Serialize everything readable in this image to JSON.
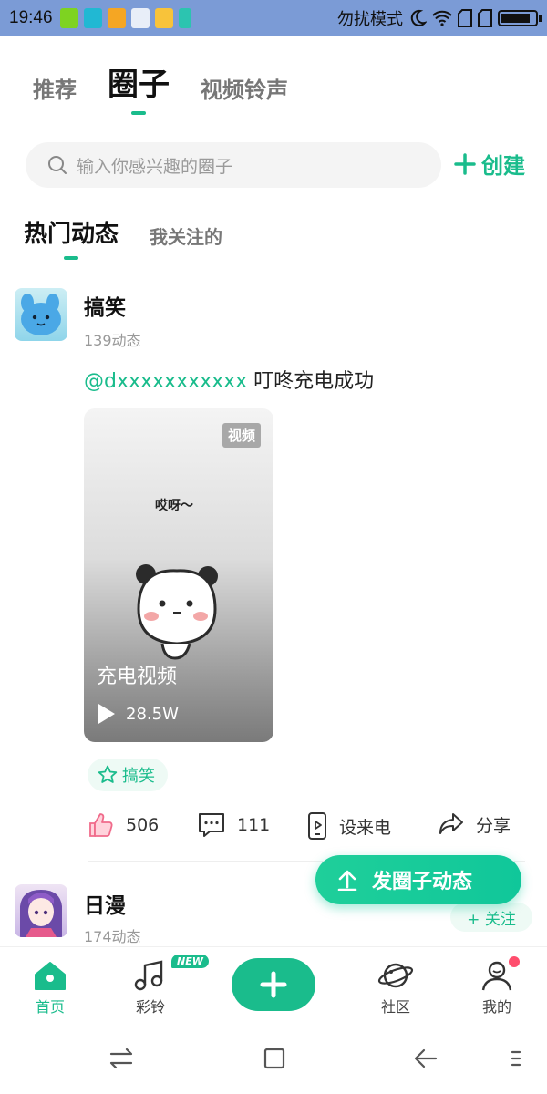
{
  "status_bar": {
    "time": "19:46",
    "mode_text": "勿扰模式",
    "battery_level": 0.85
  },
  "top_tabs": [
    {
      "label": "推荐",
      "active": false
    },
    {
      "label": "圈子",
      "active": true
    },
    {
      "label": "视频铃声",
      "active": false
    }
  ],
  "search": {
    "placeholder": "输入你感兴趣的圈子",
    "icon": "search-icon"
  },
  "create_button": {
    "label": "创建",
    "icon": "plus-icon"
  },
  "feed_tabs": [
    {
      "label": "热门动态",
      "active": true
    },
    {
      "label": "我关注的",
      "active": false
    }
  ],
  "posts": [
    {
      "name": "搞笑",
      "count": "139动态",
      "mention": "@dxxxxxxxxxxx",
      "text": " 叮咚充电成功",
      "video": {
        "badge": "视频",
        "caption": "哎呀～",
        "title": "充电视频",
        "plays": "28.5W"
      },
      "tag": "搞笑",
      "actions": {
        "likes": "506",
        "comments": "111",
        "set_ring": "设来电",
        "share": "分享"
      }
    },
    {
      "name": "日漫",
      "count": "174动态",
      "follow_label": "+ 关注"
    }
  ],
  "fab": {
    "label": "发圈子动态"
  },
  "bottom_nav": {
    "home": "首页",
    "ringtone": "彩铃",
    "new_badge": "NEW",
    "community": "社区",
    "mine": "我的"
  },
  "colors": {
    "accent": "#1abc8c",
    "status_bar": "#7b9bd6",
    "notify_dot": "#ff4d6d"
  }
}
